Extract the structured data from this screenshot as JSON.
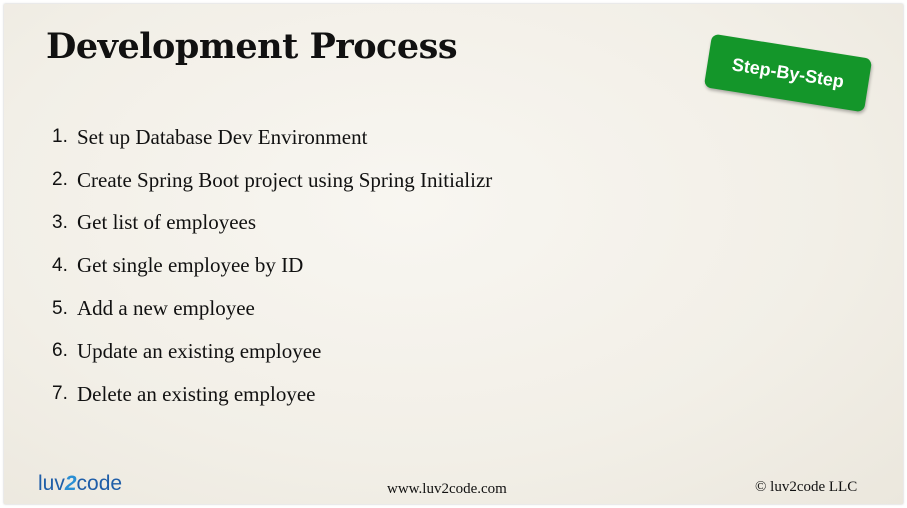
{
  "title": "Development Process",
  "badge": "Step-By-Step",
  "steps": [
    {
      "num": "1.",
      "text": "Set up Database Dev Environment"
    },
    {
      "num": "2.",
      "text": "Create Spring Boot project using Spring Initializr"
    },
    {
      "num": "3.",
      "text": "Get list of employees"
    },
    {
      "num": "4.",
      "text": "Get single employee by ID"
    },
    {
      "num": "5.",
      "text": "Add a new employee"
    },
    {
      "num": "6.",
      "text": "Update an existing employee"
    },
    {
      "num": "7.",
      "text": "Delete an existing employee"
    }
  ],
  "footer": {
    "logo": {
      "part1": "luv",
      "part2": "2",
      "part3": "code"
    },
    "url": "www.luv2code.com",
    "copyright": "© luv2code LLC"
  },
  "colors": {
    "badge": "#14962a",
    "logo_primary": "#1f5ea8",
    "logo_accent": "#2a8fd4"
  }
}
